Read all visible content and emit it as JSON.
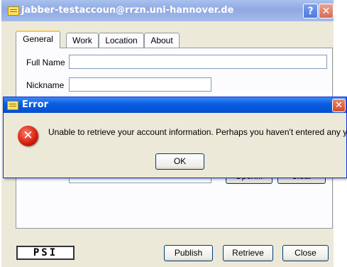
{
  "main_window": {
    "title": "jabber-testaccoun@rrzn.uni-hannover.de",
    "help_glyph": "?",
    "close_glyph": "✕"
  },
  "tabs": [
    {
      "label": "General",
      "active": true
    },
    {
      "label": "Work",
      "active": false
    },
    {
      "label": "Location",
      "active": false
    },
    {
      "label": "About",
      "active": false
    }
  ],
  "general": {
    "full_name_label": "Full Name",
    "full_name_value": "",
    "nickname_label": "Nickname",
    "nickname_value": "",
    "open_button": "Open...",
    "clear_button": "Clear"
  },
  "footer": {
    "logo_text": "PSI",
    "publish": "Publish",
    "retrieve": "Retrieve",
    "close": "Close"
  },
  "error_dialog": {
    "title": "Error",
    "close_glyph": "✕",
    "icon_glyph": "✕",
    "message": "Unable to retrieve your account information.  Perhaps you haven't entered any yet.",
    "ok_button": "OK"
  },
  "colors": {
    "dialog_titlebar": "#0a5fe0",
    "inactive_titlebar": "#9ab4e8",
    "window_bg": "#ece9d8",
    "error_icon": "#d21b0b"
  }
}
